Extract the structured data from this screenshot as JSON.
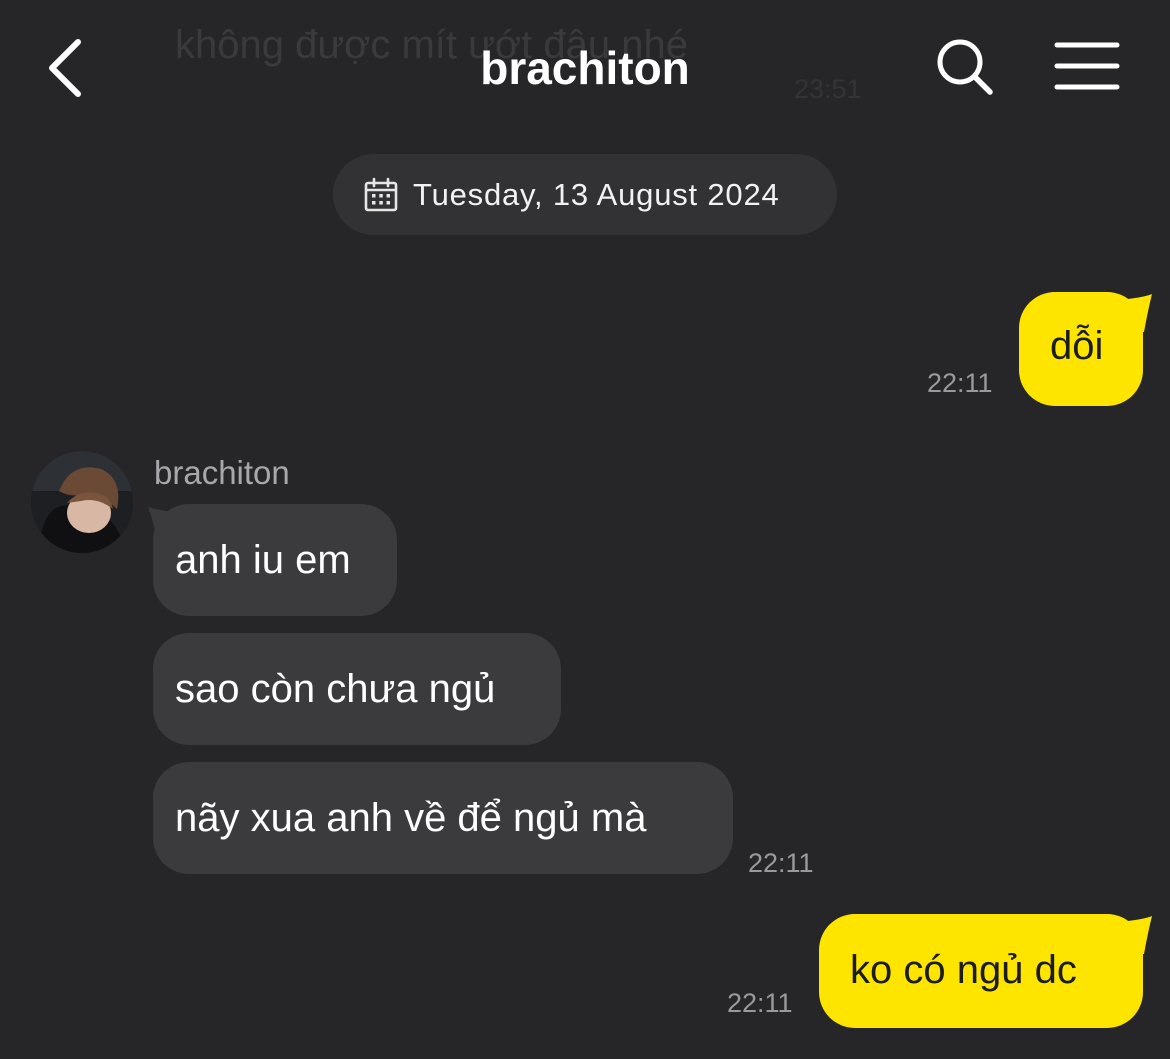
{
  "background_ghost": {
    "text": "không được mít ướt đâu nhé",
    "time": "23:51"
  },
  "header": {
    "title": "brachiton",
    "back_icon": "chevron-left-icon",
    "search_icon": "search-icon",
    "menu_icon": "hamburger-menu-icon"
  },
  "date_divider": {
    "icon": "calendar-icon",
    "text": "Tuesday, 13 August 2024"
  },
  "messages": {
    "m1": {
      "sender": "me",
      "text": "dỗi",
      "time": "22:11"
    },
    "group": {
      "sender_name": "brachiton",
      "avatar": "profile-photo",
      "items": [
        {
          "text": "anh iu em"
        },
        {
          "text": "sao còn chưa ngủ"
        },
        {
          "text": "nãy xua anh về để ngủ mà"
        }
      ],
      "time": "22:11"
    },
    "m2": {
      "sender": "me",
      "text": "ko có ngủ dc",
      "time": "22:11"
    }
  },
  "colors": {
    "background": "#262628",
    "my_bubble": "#fee500",
    "their_bubble": "#3b3b3d",
    "pill": "#323234",
    "time_text": "#9a9a9e"
  }
}
